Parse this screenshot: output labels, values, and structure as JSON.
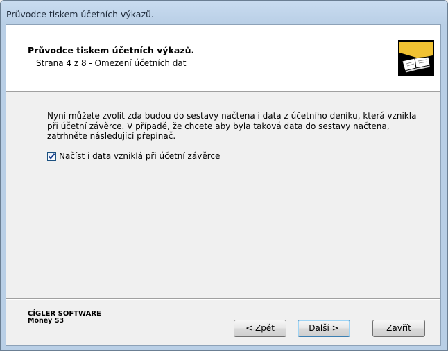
{
  "window": {
    "title": "Průvodce tiskem účetních výkazů."
  },
  "header": {
    "title": "Průvodce tiskem účetních výkazů.",
    "subtitle": "Strana 4 z 8 - Omezení účetních dat"
  },
  "main": {
    "description": "Nyní můžete zvolit zda budou do sestavy načtena i data z účetního deníku, která vznikla při účetní závěrce. V případě, že chcete aby byla taková data do sestavy načtena, zatrhněte následující přepínač.",
    "checkbox": {
      "label": "Načíst i data vzniklá při účetní závěrce",
      "checked": true
    }
  },
  "footer": {
    "brand_line1": "CÍGLER SOFTWARE",
    "brand_line2": "Money S3",
    "buttons": {
      "back_prefix": "< ",
      "back_mnemonic": "Z",
      "back_rest": "pět",
      "next_prefix": "Da",
      "next_mnemonic": "l",
      "next_rest": "ší >",
      "close_label": "Zavřít"
    }
  },
  "icons": {
    "logo": "book-icon",
    "check": "checkmark-icon"
  },
  "colors": {
    "frame": "#b9cfe6",
    "header_bg": "#ffffff",
    "dialog_bg": "#f0f0f0",
    "default_button_border": "#3c7fb1"
  }
}
